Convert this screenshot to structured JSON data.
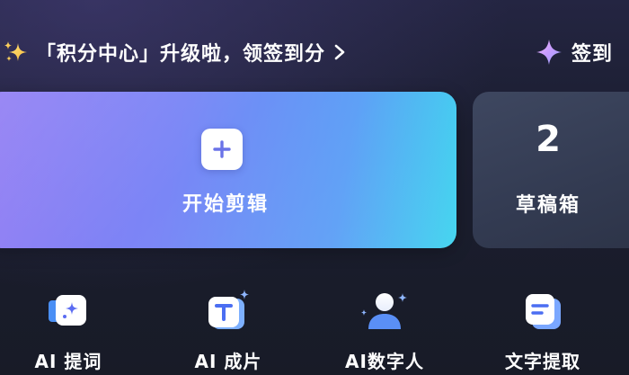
{
  "banner": {
    "icon": "sparkles-icon",
    "text": "「积分中心」升级啦，领签到分",
    "chevron_icon": "chevron-right-icon"
  },
  "checkin": {
    "icon": "diamond-sparkle-icon",
    "label": "签到"
  },
  "start_card": {
    "icon": "plus-icon",
    "label": "开始剪辑"
  },
  "draft_card": {
    "count": "2",
    "label": "草稿箱"
  },
  "tools": [
    {
      "icon": "ai-prompt-icon",
      "label": "AI 提词"
    },
    {
      "icon": "ai-video-icon",
      "label": "AI 成片"
    },
    {
      "icon": "digital-human-icon",
      "label": "AI数字人"
    },
    {
      "icon": "text-extract-icon",
      "label": "文字提取"
    }
  ],
  "colors": {
    "background": "#1a1d2e",
    "start_gradient_left": "#8e78f3",
    "start_gradient_right": "#37d2ee",
    "draft_card": "#394158",
    "text": "#ffffff"
  }
}
